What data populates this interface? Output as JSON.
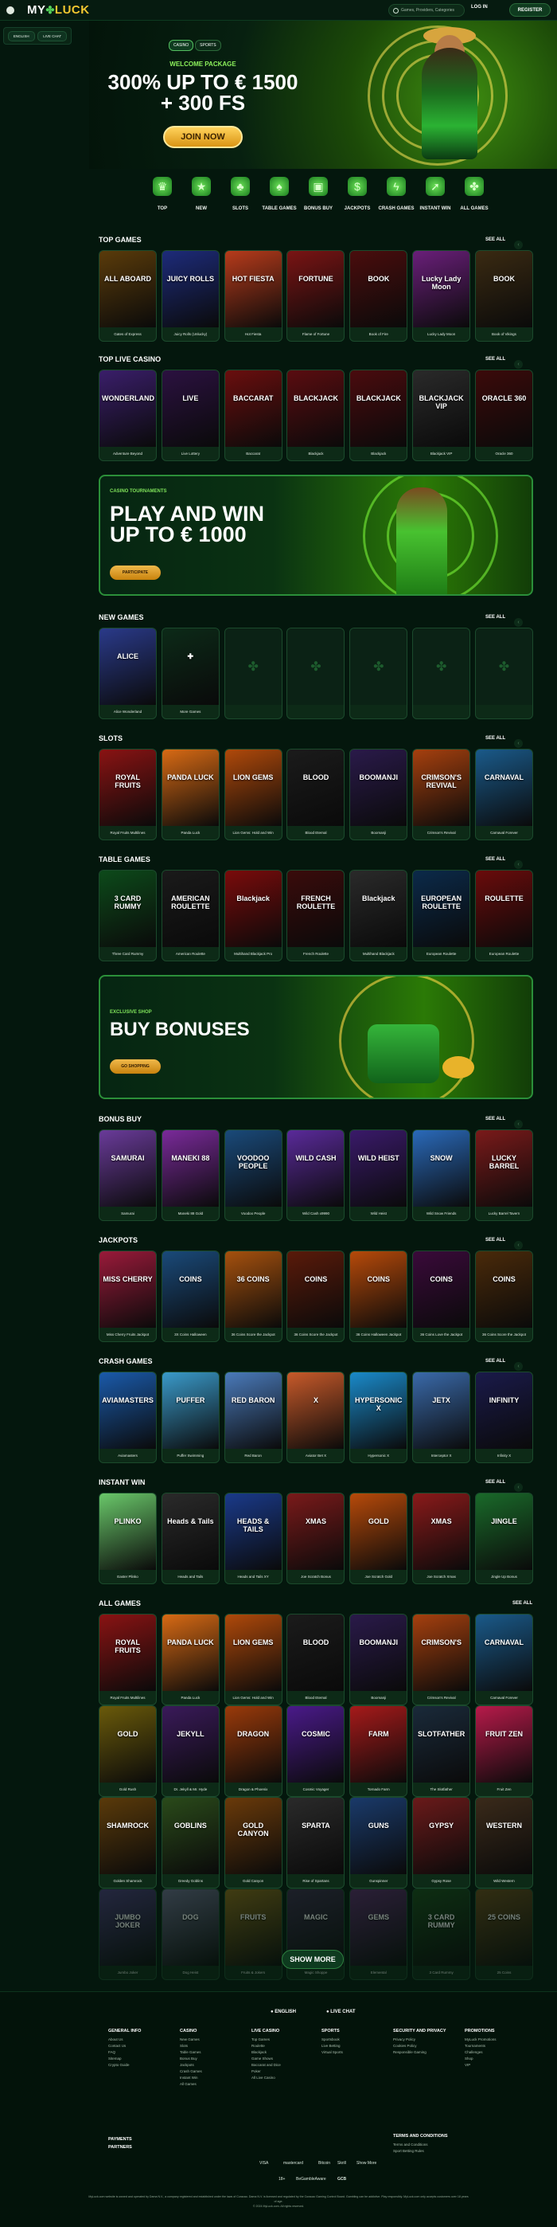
{
  "header": {
    "logo_a": "MY",
    "logo_b": "LUCK",
    "search_placeholder": "Games, Providers, Categories",
    "login_label": "LOG IN",
    "register_label": "REGISTER"
  },
  "sidebar": {
    "language": "ENGLISH",
    "chat": "LIVE CHAT"
  },
  "hero": {
    "tabs": [
      "CASINO",
      "SPORTS"
    ],
    "welcome": "WELCOME PACKAGE",
    "title_line1": "300% UP TO € 1500",
    "title_line2": "+ 300 FS",
    "cta": "JOIN NOW"
  },
  "categories": [
    {
      "label": "TOP",
      "icon": "top-hat-icon",
      "glyph": "♛"
    },
    {
      "label": "NEW",
      "icon": "star-icon",
      "glyph": "★"
    },
    {
      "label": "SLOTS",
      "icon": "clover-icon",
      "glyph": "♣"
    },
    {
      "label": "TABLE GAMES",
      "icon": "cards-icon",
      "glyph": "♠"
    },
    {
      "label": "BONUS BUY",
      "icon": "gift-icon",
      "glyph": "▣"
    },
    {
      "label": "JACKPOTS",
      "icon": "coin-icon",
      "glyph": "$"
    },
    {
      "label": "CRASH GAMES",
      "icon": "lightning-icon",
      "glyph": "ϟ"
    },
    {
      "label": "INSTANT WIN",
      "icon": "rocket-icon",
      "glyph": "➚"
    },
    {
      "label": "ALL GAMES",
      "icon": "clover-group-icon",
      "glyph": "✤"
    }
  ],
  "see_all": "SEE ALL",
  "top_games": {
    "title": "TOP GAMES",
    "games": [
      {
        "name": "Gates of Express",
        "thumb": "ALL ABOARD",
        "color": "#5a3b0a"
      },
      {
        "name": "Juicy Rolls (Unlucky)",
        "thumb": "JUICY ROLLS",
        "color": "#1d2b7a"
      },
      {
        "name": "Hot Fiesta",
        "thumb": "HOT FIESTA",
        "color": "#b73b1b"
      },
      {
        "name": "Flame of Fortune",
        "thumb": "FORTUNE",
        "color": "#7a1414"
      },
      {
        "name": "Book of Fire",
        "thumb": "BOOK",
        "color": "#4a0d0d"
      },
      {
        "name": "Lucky Lady Moon",
        "thumb": "Lucky Lady Moon",
        "color": "#6a1f7a"
      },
      {
        "name": "Book of Vikings",
        "thumb": "BOOK",
        "color": "#3a2a12"
      }
    ]
  },
  "top_live": {
    "title": "TOP LIVE CASINO",
    "games": [
      {
        "name": "Adventure Beyond",
        "thumb": "WONDERLAND",
        "color": "#3a1e6a"
      },
      {
        "name": "Live Lottery",
        "thumb": "LIVE",
        "color": "#2b1140"
      },
      {
        "name": "Baccarat",
        "thumb": "BACCARAT",
        "color": "#6a0e0e"
      },
      {
        "name": "Blackjack",
        "thumb": "BLACKJACK",
        "color": "#5a0c10"
      },
      {
        "name": "Blackjack",
        "thumb": "BLACKJACK",
        "color": "#4a0b0e"
      },
      {
        "name": "Blackjack VIP",
        "thumb": "BLACKJACK VIP",
        "color": "#2a2a2a"
      },
      {
        "name": "Oracle 360",
        "thumb": "ORACLE 360",
        "color": "#3b0a0a"
      }
    ]
  },
  "tournament": {
    "small": "CASINO TOURNAMENTS",
    "title_line1": "PLAY AND WIN",
    "title_line2": "UP TO € 1000",
    "cta": "PARTICIPATE"
  },
  "new_games": {
    "title": "NEW GAMES",
    "games": [
      {
        "name": "Alice Wonderland",
        "thumb": "ALICE",
        "color": "#2a3a8a"
      },
      {
        "name": "More Games",
        "thumb": "✚",
        "color": "#0c2a18"
      },
      {
        "name": "",
        "thumb": "",
        "color": ""
      },
      {
        "name": "",
        "thumb": "",
        "color": ""
      },
      {
        "name": "",
        "thumb": "",
        "color": ""
      },
      {
        "name": "",
        "thumb": "",
        "color": ""
      },
      {
        "name": "",
        "thumb": "",
        "color": ""
      }
    ]
  },
  "slots": {
    "title": "SLOTS",
    "games": [
      {
        "name": "Royal Fruits Multilines",
        "thumb": "ROYAL FRUITS",
        "color": "#8a1313"
      },
      {
        "name": "Panda Luck",
        "thumb": "PANDA LUCK",
        "color": "#d86a14"
      },
      {
        "name": "Lion Gems: Hold and Win",
        "thumb": "LION GEMS",
        "color": "#b0490a"
      },
      {
        "name": "Blood Eternal",
        "thumb": "BLOOD",
        "color": "#1b1b1b"
      },
      {
        "name": "Boomanji",
        "thumb": "BOOMANJI",
        "color": "#2a1a4a"
      },
      {
        "name": "Crimson's Revival",
        "thumb": "CRIMSON'S REVIVAL",
        "color": "#a6400e"
      },
      {
        "name": "Carnaval Forever",
        "thumb": "CARNAVAL",
        "color": "#1a5a8a"
      }
    ]
  },
  "table_games": {
    "title": "TABLE GAMES",
    "games": [
      {
        "name": "Three Card Rummy",
        "thumb": "3 CARD RUMMY",
        "color": "#0d4a1a"
      },
      {
        "name": "American Roulette",
        "thumb": "AMERICAN ROULETTE",
        "color": "#1a1a1a"
      },
      {
        "name": "Multihand Blackjack Pro",
        "thumb": "Blackjack",
        "color": "#7a0b0b"
      },
      {
        "name": "French Roulette",
        "thumb": "FRENCH ROULETTE",
        "color": "#3a0b0b"
      },
      {
        "name": "Multihand Blackjack",
        "thumb": "Blackjack",
        "color": "#2a2a2a"
      },
      {
        "name": "European Roulette",
        "thumb": "EUROPEAN ROULETTE",
        "color": "#0b2a4a"
      },
      {
        "name": "European Roulette",
        "thumb": "ROULETTE",
        "color": "#6a0b0b"
      }
    ]
  },
  "shop": {
    "small": "EXCLUSIVE SHOP",
    "title": "BUY BONUSES",
    "cta": "GO SHOPPING"
  },
  "bonus_buy": {
    "title": "BONUS BUY",
    "games": [
      {
        "name": "Samurai",
        "thumb": "SAMURAI",
        "color": "#6a3b9a"
      },
      {
        "name": "Maneki 88 Gold",
        "thumb": "MANEKI 88",
        "color": "#7a2a9a"
      },
      {
        "name": "Voodoo People",
        "thumb": "VOODOO PEOPLE",
        "color": "#1a4a7a"
      },
      {
        "name": "Wild Cash x9990",
        "thumb": "WILD CASH",
        "color": "#5a2a9a"
      },
      {
        "name": "Wild Heist",
        "thumb": "WILD HEIST",
        "color": "#3a1a6a"
      },
      {
        "name": "Wild Snow Friends",
        "thumb": "SNOW",
        "color": "#2a6aba"
      },
      {
        "name": "Lucky Barrel Tavern",
        "thumb": "LUCKY BARREL",
        "color": "#7a1a1a"
      }
    ]
  },
  "jackpots": {
    "title": "JACKPOTS",
    "games": [
      {
        "name": "Miss Cherry Fruits Jackpot",
        "thumb": "MISS CHERRY",
        "color": "#9a1a3a"
      },
      {
        "name": "3X Coins Halloween",
        "thumb": "COINS",
        "color": "#1a4a7a"
      },
      {
        "name": "36 Coins Score the Jackpot",
        "thumb": "36 COINS",
        "color": "#a6510e"
      },
      {
        "name": "36 Coins Score the Jackpot",
        "thumb": "COINS",
        "color": "#5a1a0a"
      },
      {
        "name": "36 Coins Halloween Jackpot",
        "thumb": "COINS",
        "color": "#b74a0a"
      },
      {
        "name": "36 Coins Love the Jackpot",
        "thumb": "COINS",
        "color": "#3a0a3a"
      },
      {
        "name": "36 Coins Score the Jackpot",
        "thumb": "COINS",
        "color": "#4a2a0a"
      }
    ]
  },
  "crash_games": {
    "title": "CRASH GAMES",
    "games": [
      {
        "name": "Aviamasters",
        "thumb": "AVIAMASTERS",
        "color": "#1a5aaa"
      },
      {
        "name": "Puffer Swimming",
        "thumb": "PUFFER",
        "color": "#3a9aca"
      },
      {
        "name": "Red Baron",
        "thumb": "RED BARON",
        "color": "#4a7aba"
      },
      {
        "name": "Aviator Bet X",
        "thumb": "X",
        "color": "#c85a2a"
      },
      {
        "name": "Hypersonic X",
        "thumb": "HYPERSONIC X",
        "color": "#1a8aca"
      },
      {
        "name": "Interceptor X",
        "thumb": "JETX",
        "color": "#3a6aaa"
      },
      {
        "name": "Infinity X",
        "thumb": "INFINITY",
        "color": "#1a1a4a"
      }
    ]
  },
  "instant_win": {
    "title": "INSTANT WIN",
    "games": [
      {
        "name": "Easter Plinko",
        "thumb": "PLINKO",
        "color": "#6ac86a"
      },
      {
        "name": "Heads and Tails",
        "thumb": "Heads & Tails",
        "color": "#2a2a2a"
      },
      {
        "name": "Heads and Tails XY",
        "thumb": "HEADS & TAILS",
        "color": "#1a3a8a"
      },
      {
        "name": "Joe Scratch Bonus",
        "thumb": "XMAS",
        "color": "#7a1a1a"
      },
      {
        "name": "Joe Scratch Gold",
        "thumb": "GOLD",
        "color": "#b74a0a"
      },
      {
        "name": "Joe Scratch Xmas",
        "thumb": "XMAS",
        "color": "#8a1a1a"
      },
      {
        "name": "Jingle Up Bonus",
        "thumb": "JINGLE",
        "color": "#1a6a2a"
      }
    ]
  },
  "all_games": {
    "title": "ALL GAMES",
    "row1": [
      {
        "name": "Royal Fruits Multilines",
        "thumb": "ROYAL FRUITS",
        "color": "#8a1313"
      },
      {
        "name": "Panda Luck",
        "thumb": "PANDA LUCK",
        "color": "#d86a14"
      },
      {
        "name": "Lion Gems: Hold and Win",
        "thumb": "LION GEMS",
        "color": "#b0490a"
      },
      {
        "name": "Blood Eternal",
        "thumb": "BLOOD",
        "color": "#1b1b1b"
      },
      {
        "name": "Boomanji",
        "thumb": "BOOMANJI",
        "color": "#2a1a4a"
      },
      {
        "name": "Crimson's Revival",
        "thumb": "CRIMSON'S",
        "color": "#a6400e"
      },
      {
        "name": "Carnaval Forever",
        "thumb": "CARNAVAL",
        "color": "#1a5a8a"
      }
    ],
    "row2": [
      {
        "name": "Gold Rush",
        "thumb": "GOLD",
        "color": "#6a5a0a"
      },
      {
        "name": "Dr. Jekyll & Mr. Hyde",
        "thumb": "JEKYLL",
        "color": "#3a1a5a"
      },
      {
        "name": "Dragon & Phoenix",
        "thumb": "DRAGON",
        "color": "#9a3a0a"
      },
      {
        "name": "Cosmic Voyager",
        "thumb": "COSMIC",
        "color": "#4a1a8a"
      },
      {
        "name": "Tornado Farm",
        "thumb": "FARM",
        "color": "#a61a1a"
      },
      {
        "name": "The Slotfather",
        "thumb": "SLOTFATHER",
        "color": "#1a2a3a"
      },
      {
        "name": "Fruit Zen",
        "thumb": "FRUIT ZEN",
        "color": "#b71a4a"
      }
    ],
    "row3": [
      {
        "name": "Golden Shamrock",
        "thumb": "SHAMROCK",
        "color": "#5a3a0a"
      },
      {
        "name": "Greedy Goblins",
        "thumb": "GOBLINS",
        "color": "#2a4a1a"
      },
      {
        "name": "Gold Canyon",
        "thumb": "GOLD CANYON",
        "color": "#6a3a0a"
      },
      {
        "name": "Rise of Spartans",
        "thumb": "SPARTA",
        "color": "#2a2a2a"
      },
      {
        "name": "Gunspinner",
        "thumb": "GUNS",
        "color": "#1a3a6a"
      },
      {
        "name": "Gypsy Rose",
        "thumb": "GYPSY",
        "color": "#6a1a1a"
      },
      {
        "name": "Wild Western",
        "thumb": "WESTERN",
        "color": "#3a2a1a"
      }
    ],
    "row4": [
      {
        "name": "Jumbo Joker",
        "thumb": "JUMBO JOKER",
        "color": "#4a3a7a"
      },
      {
        "name": "Dog Heist",
        "thumb": "DOG",
        "color": "#6a6a8a"
      },
      {
        "name": "Fruits & Jokers",
        "thumb": "FRUITS",
        "color": "#8a6a1a"
      },
      {
        "name": "Magic Shoppe",
        "thumb": "MAGIC",
        "color": "#3a2a4a"
      },
      {
        "name": "Elemental",
        "thumb": "GEMS",
        "color": "#5a2a6a"
      },
      {
        "name": "3 Card Rummy",
        "thumb": "3 CARD RUMMY",
        "color": "#1a4a1a"
      },
      {
        "name": "25 Coins",
        "thumb": "25 COINS",
        "color": "#6a4a1a"
      }
    ],
    "show_more": "SHOW MORE"
  },
  "footer": {
    "language": "ENGLISH",
    "chat": "LIVE CHAT",
    "columns": [
      {
        "title": "GENERAL INFO",
        "links": [
          "About Us",
          "Contact Us",
          "FAQ",
          "Sitemap",
          "Crypto Guide"
        ]
      },
      {
        "title": "CASINO",
        "links": [
          "New Games",
          "Slots",
          "Table Games",
          "Bonus Buy",
          "Jackpots",
          "Crash Games",
          "Instant Win",
          "All Games"
        ]
      },
      {
        "title": "LIVE CASINO",
        "links": [
          "Top Games",
          "Roulette",
          "Blackjack",
          "Game Shows",
          "Baccarat and Dice",
          "Poker",
          "All Live Casino"
        ]
      },
      {
        "title": "SPORTS",
        "links": [
          "Sportsbook",
          "Live Betting",
          "Virtual Sports"
        ]
      },
      {
        "title": "SECURITY AND PRIVACY",
        "links": [
          "Privacy Policy",
          "Cookies Policy",
          "Responsible Gaming"
        ]
      },
      {
        "title": "PROMOTIONS",
        "links": [
          "MyLuck Promotions",
          "Tournaments",
          "Challenges",
          "Shop",
          "VIP"
        ]
      }
    ],
    "payments": "PAYMENTS",
    "partners": "PARTNERS",
    "terms_title": "TERMS AND CONDITIONS",
    "terms_links": [
      "Terms and Conditions",
      "Sport Betting Rules"
    ],
    "pay_methods": [
      "VISA",
      "mastercard",
      "Bitcoin",
      "Skrill",
      "Show More"
    ],
    "badges": [
      "18+",
      "BeGambleAware",
      "GCB"
    ],
    "legal": "MyLuck.com website is owned and operated by Dama N.V., a company registered and established under the laws of Curacao. Dama N.V. is licensed and regulated by the Curacao Gaming Control Board. Gambling can be addictive. Play responsibly. MyLuck.com only accepts customers over 18 years of age.",
    "copyright": "© 2024 MyLuck.com. All rights reserved."
  }
}
